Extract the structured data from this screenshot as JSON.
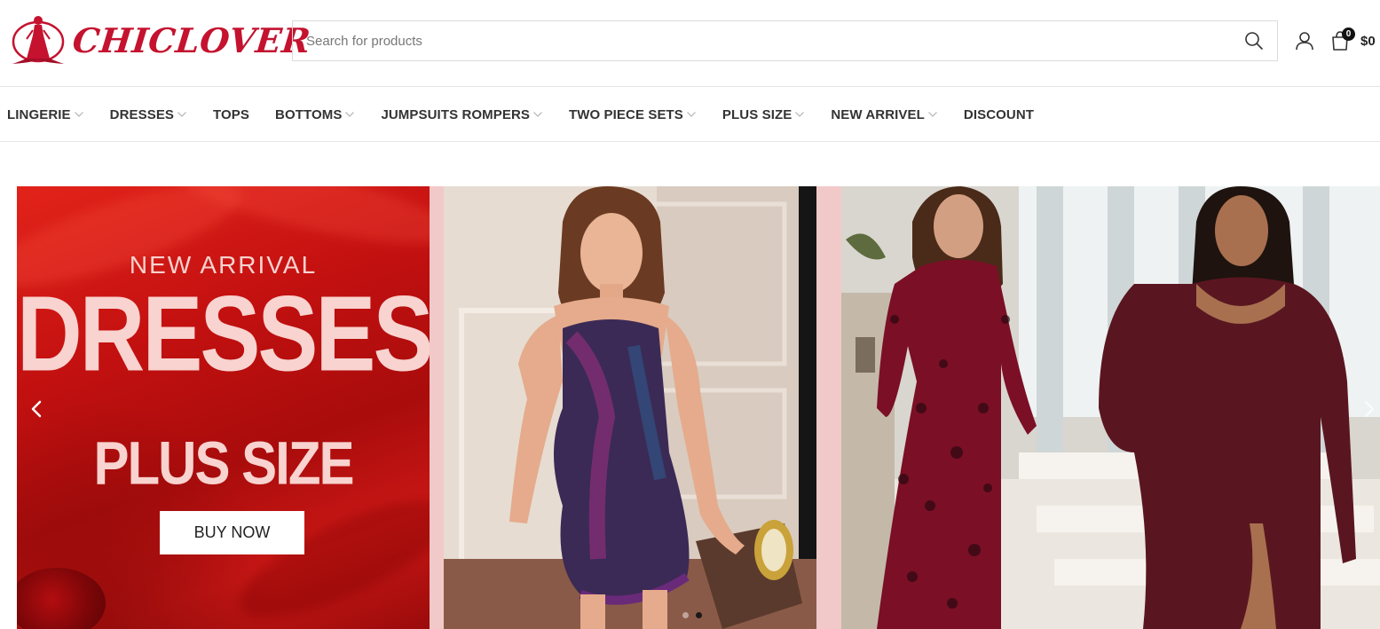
{
  "brand": {
    "name": "CHICLOVER",
    "accent_color": "#c4122f"
  },
  "search": {
    "placeholder": "Search for products",
    "icon": "search-icon"
  },
  "header_actions": {
    "account_icon": "user-icon",
    "cart_icon": "shopping-bag-icon",
    "cart_count": "0",
    "cart_total": "$0"
  },
  "nav": {
    "items": [
      {
        "label": "LINGERIE",
        "has_dropdown": true
      },
      {
        "label": "DRESSES",
        "has_dropdown": true
      },
      {
        "label": "TOPS",
        "has_dropdown": false
      },
      {
        "label": "BOTTOMS",
        "has_dropdown": true
      },
      {
        "label": "JUMPSUITS ROMPERS",
        "has_dropdown": true
      },
      {
        "label": "TWO PIECE SETS",
        "has_dropdown": true
      },
      {
        "label": "PLUS SIZE",
        "has_dropdown": true
      },
      {
        "label": "NEW ARRIVEL",
        "has_dropdown": true
      },
      {
        "label": "DISCOUNT",
        "has_dropdown": false
      }
    ]
  },
  "hero": {
    "promo": {
      "subtitle": "NEW ARRIVAL",
      "headline": "DRESSES",
      "tagline": "PLUS SIZE",
      "cta": "BUY NOW",
      "background_color": "#c21010",
      "text_color": "#f8d3cf"
    },
    "prev_icon": "chevron-left-icon",
    "next_icon": "chevron-right-icon",
    "slides_total": 2,
    "active_slide": 2
  }
}
